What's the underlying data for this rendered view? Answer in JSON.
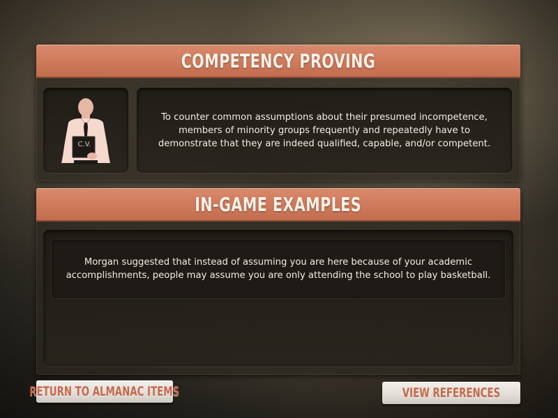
{
  "top_panel": {
    "title": "COMPETENCY PROVING",
    "description": "To counter common assumptions about their presumed incompetence, members of minority groups frequently and repeatedly have to demonstrate that they are indeed qualified, capable, and/or competent.",
    "portrait": {
      "icon": "person-holding-cv-icon",
      "cv_label": "C.V."
    }
  },
  "bottom_panel": {
    "title": "IN-GAME EXAMPLES",
    "example_text": "Morgan suggested that instead of assuming you are here because of your academic accomplishments, people may assume you are only attending the school to play basketball."
  },
  "buttons": {
    "return_label": "RETURN TO ALMANAC ITEMS",
    "references_label": "VIEW REFERENCES"
  },
  "colors": {
    "header_accent": "#d3825f",
    "button_text": "#c46a4c"
  }
}
